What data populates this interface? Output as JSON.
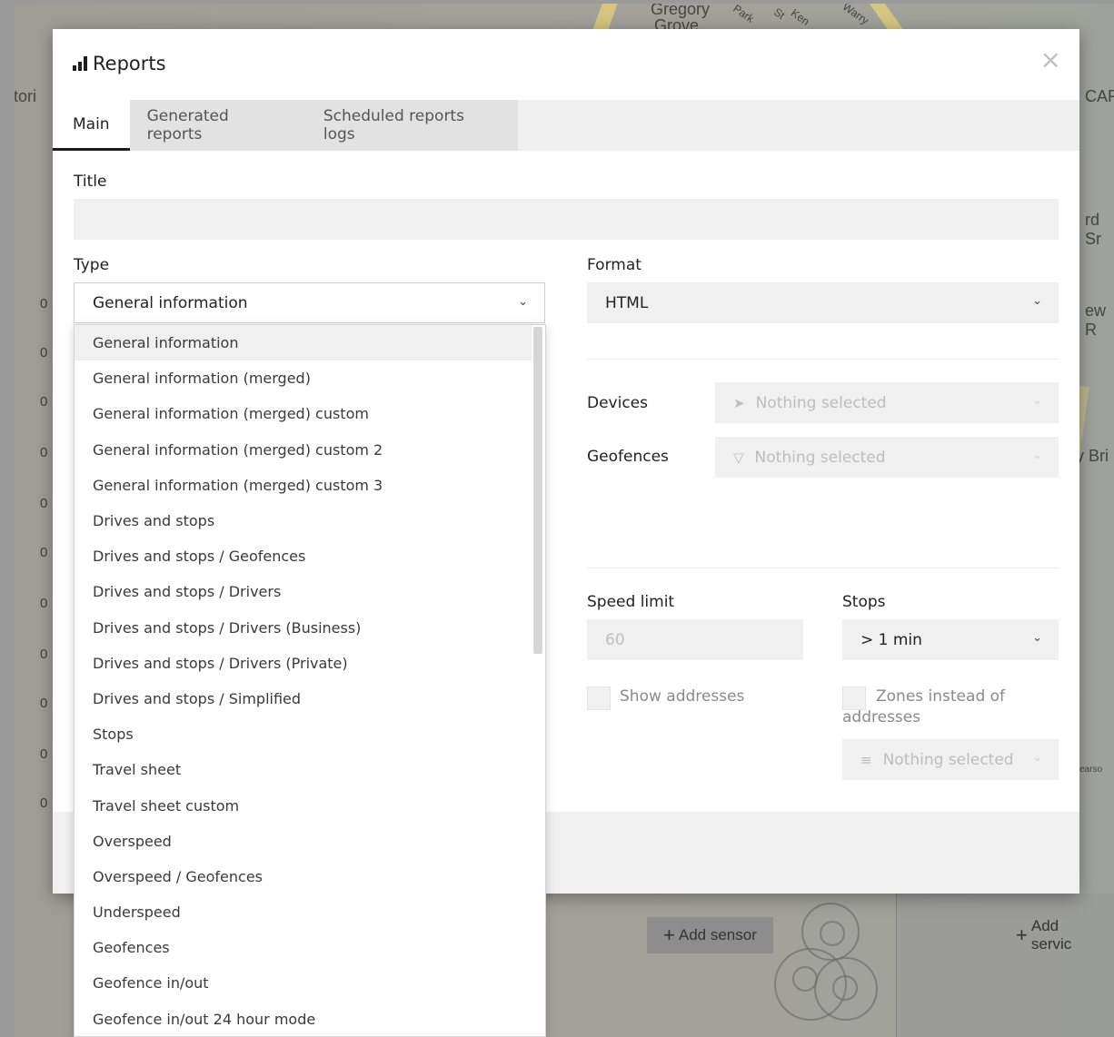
{
  "background": {
    "map_labels": [
      "Gregory",
      "Grove",
      "Park",
      "St",
      "Ken",
      "Warry",
      "CAF",
      "attori",
      "rd Sr",
      "ew R",
      "y Bri",
      "earso"
    ],
    "left_values": [
      "0",
      "0",
      "0",
      "0",
      "0",
      "0",
      "0",
      "0",
      "0",
      "0",
      "0"
    ],
    "add_sensor_label": "Add sensor",
    "add_service_label": "Add servic"
  },
  "modal": {
    "title": "Reports",
    "close_glyph": "×",
    "tabs": [
      {
        "label": "Main"
      },
      {
        "label": "Generated reports"
      },
      {
        "label": "Scheduled reports logs"
      }
    ],
    "title_field": {
      "label": "Title",
      "value": ""
    },
    "type_field": {
      "label": "Type",
      "value": "General information"
    },
    "format_field": {
      "label": "Format",
      "value": "HTML"
    },
    "devices_field": {
      "label": "Devices",
      "value": "Nothing selected"
    },
    "geofences_field": {
      "label": "Geofences",
      "value": "Nothing selected"
    },
    "speed_limit_field": {
      "label": "Speed limit",
      "placeholder": "60"
    },
    "stops_field": {
      "label": "Stops",
      "value": "> 1 min"
    },
    "show_addresses": {
      "label": "Show addresses",
      "checked": false
    },
    "zones_instead": {
      "label": "Zones instead of addresses",
      "checked": false
    },
    "zones_select": {
      "value": "Nothing selected"
    }
  },
  "type_dropdown": {
    "options": [
      "General information",
      "General information (merged)",
      "General information (merged) custom",
      "General information (merged) custom 2",
      "General information (merged) custom 3",
      "Drives and stops",
      "Drives and stops / Geofences",
      "Drives and stops / Drivers",
      "Drives and stops / Drivers (Business)",
      "Drives and stops / Drivers (Private)",
      "Drives and stops / Simplified",
      "Stops",
      "Travel sheet",
      "Travel sheet custom",
      "Overspeed",
      "Overspeed / Geofences",
      "Underspeed",
      "Geofences",
      "Geofence in/out",
      "Geofence in/out 24 hour mode"
    ],
    "selected_index": 0
  },
  "colors": {
    "accent": "#1a1a1a",
    "muted_text": "#bdbdbd",
    "field_bg": "#f0f0f0",
    "road": "#e6d277"
  },
  "icons": {
    "title": "bar-chart-icon",
    "close": "close-icon",
    "devices": "location-arrow-icon",
    "geofences": "geofence-triangle-icon",
    "zones": "list-icon",
    "chevron": "chevron-down-icon",
    "add": "plus-icon",
    "settings": "gear-icon"
  }
}
